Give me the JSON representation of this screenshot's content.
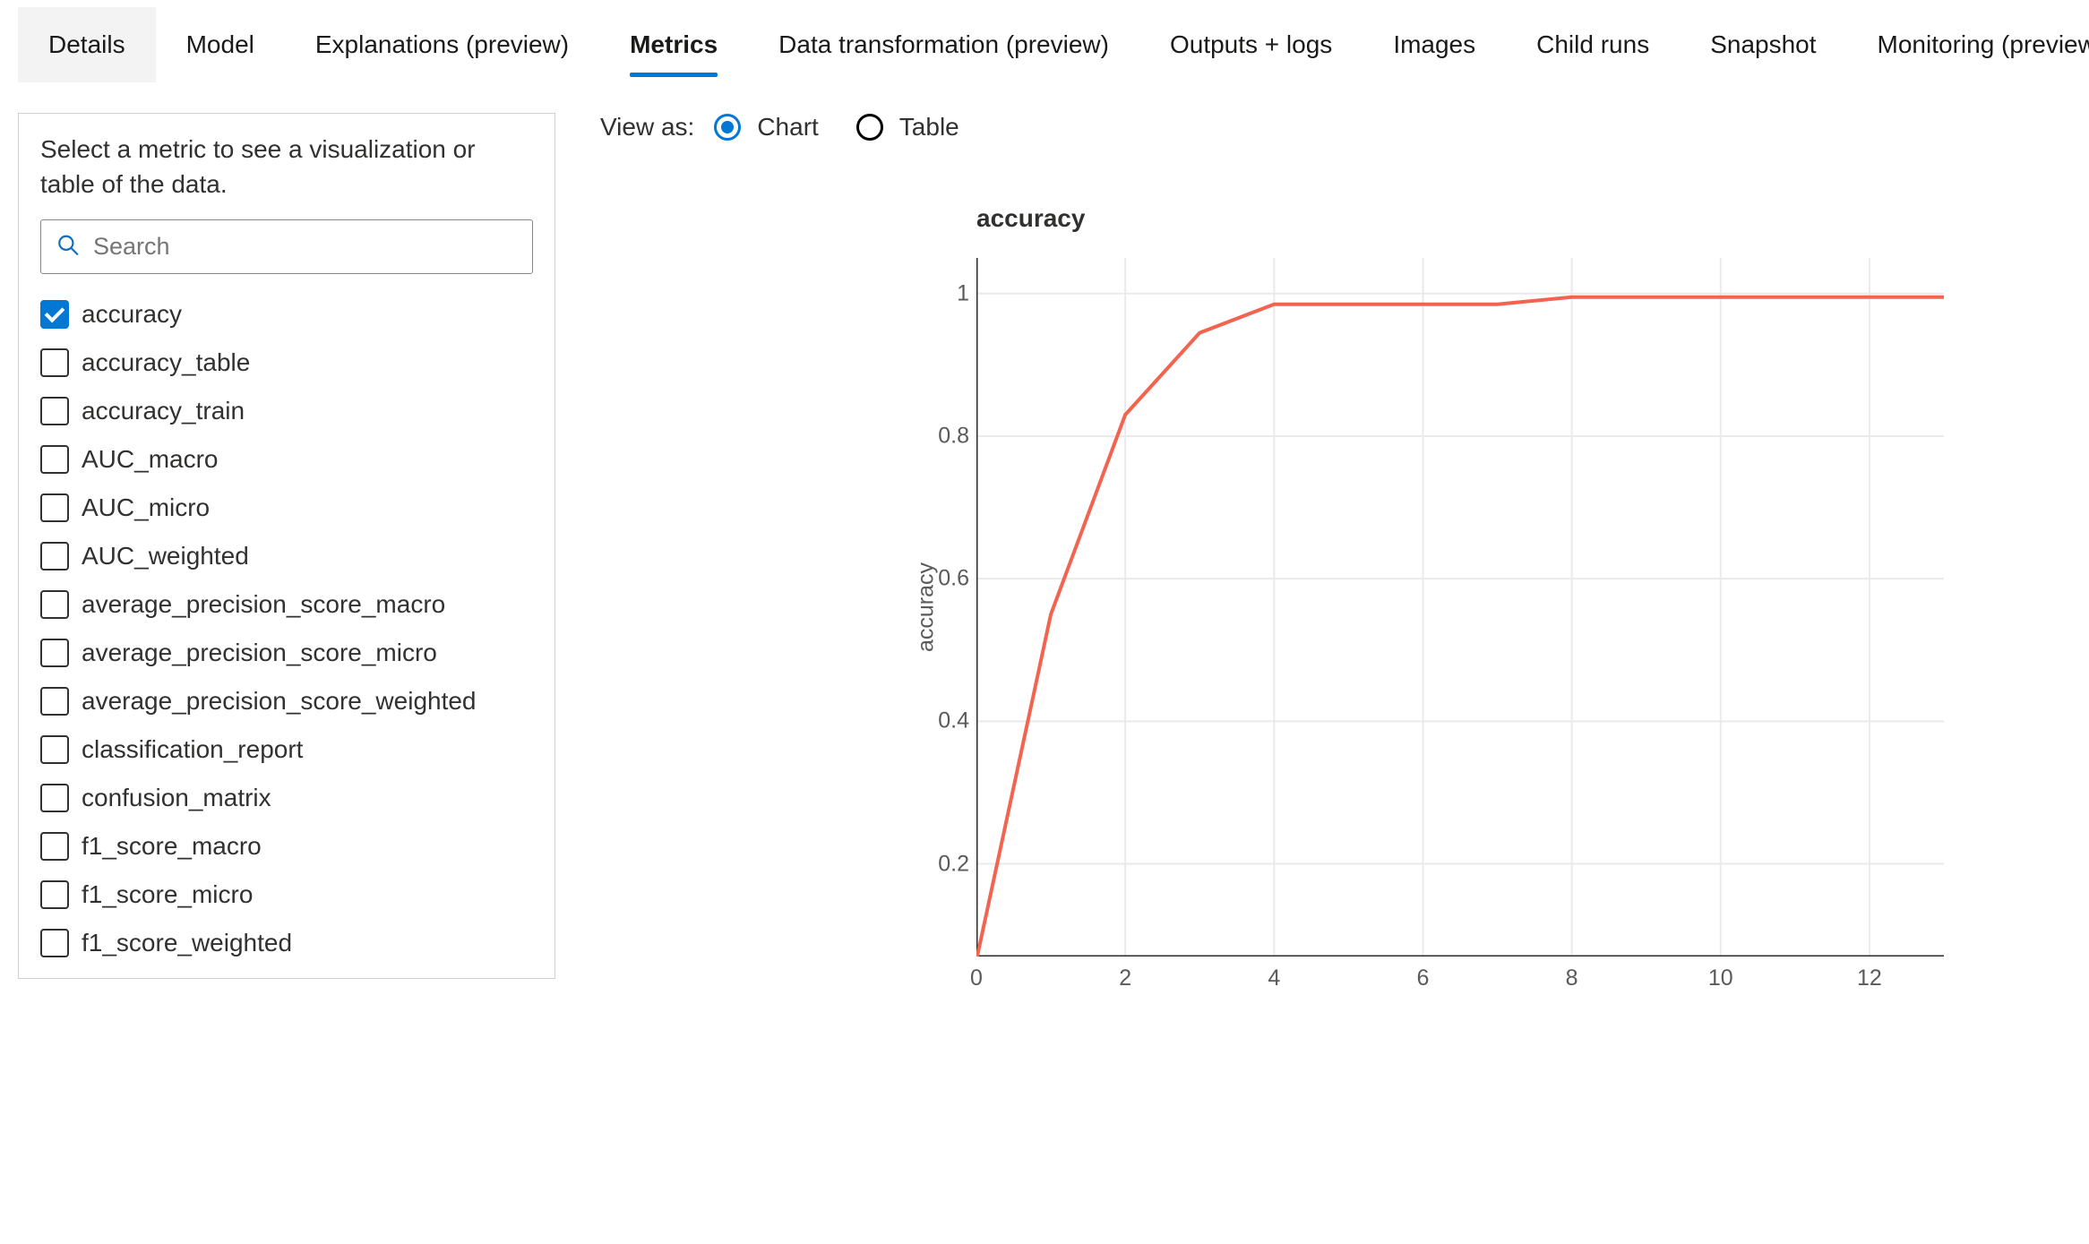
{
  "tabs": [
    {
      "label": "Details",
      "selected": false,
      "shaded": true
    },
    {
      "label": "Model",
      "selected": false,
      "shaded": false
    },
    {
      "label": "Explanations (preview)",
      "selected": false,
      "shaded": false
    },
    {
      "label": "Metrics",
      "selected": true,
      "shaded": false
    },
    {
      "label": "Data transformation (preview)",
      "selected": false,
      "shaded": false
    },
    {
      "label": "Outputs + logs",
      "selected": false,
      "shaded": false
    },
    {
      "label": "Images",
      "selected": false,
      "shaded": false
    },
    {
      "label": "Child runs",
      "selected": false,
      "shaded": false
    },
    {
      "label": "Snapshot",
      "selected": false,
      "shaded": false
    },
    {
      "label": "Monitoring (preview)",
      "selected": false,
      "shaded": false
    }
  ],
  "sidebar": {
    "help": "Select a metric to see a visualization or table of the data.",
    "search_placeholder": "Search"
  },
  "metrics": [
    {
      "label": "accuracy",
      "checked": true
    },
    {
      "label": "accuracy_table",
      "checked": false
    },
    {
      "label": "accuracy_train",
      "checked": false
    },
    {
      "label": "AUC_macro",
      "checked": false
    },
    {
      "label": "AUC_micro",
      "checked": false
    },
    {
      "label": "AUC_weighted",
      "checked": false
    },
    {
      "label": "average_precision_score_macro",
      "checked": false
    },
    {
      "label": "average_precision_score_micro",
      "checked": false
    },
    {
      "label": "average_precision_score_weighted",
      "checked": false
    },
    {
      "label": "classification_report",
      "checked": false
    },
    {
      "label": "confusion_matrix",
      "checked": false
    },
    {
      "label": "f1_score_macro",
      "checked": false
    },
    {
      "label": "f1_score_micro",
      "checked": false
    },
    {
      "label": "f1_score_weighted",
      "checked": false
    }
  ],
  "view_as": {
    "label": "View as:",
    "options": [
      {
        "label": "Chart",
        "selected": true
      },
      {
        "label": "Table",
        "selected": false
      }
    ]
  },
  "chart_data": {
    "type": "line",
    "title": "accuracy",
    "ylabel": "accuracy",
    "xlabel": "",
    "x": [
      0,
      1,
      2,
      3,
      4,
      5,
      6,
      7,
      8,
      9,
      10,
      11,
      12,
      13
    ],
    "values": [
      0.065,
      0.55,
      0.83,
      0.945,
      0.985,
      0.985,
      0.985,
      0.985,
      0.995,
      0.995,
      0.995,
      0.995,
      0.995,
      0.995
    ],
    "xlim": [
      0,
      13
    ],
    "ylim": [
      0.07,
      1.05
    ],
    "xticks": [
      0,
      2,
      4,
      6,
      8,
      10,
      12
    ],
    "yticks": [
      0.2,
      0.4,
      0.6,
      0.8,
      1.0
    ]
  }
}
